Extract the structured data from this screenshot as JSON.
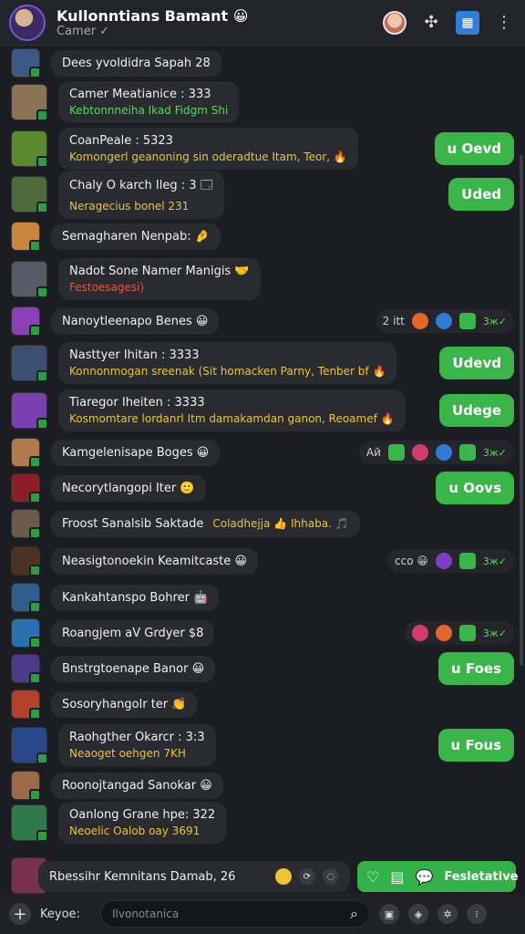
{
  "header": {
    "title": "Kullonntians Bamant 😀",
    "subtitle": "Camer ✓",
    "icons": [
      "profile-picture-icon",
      "puzzle-icon",
      "app-grid-icon",
      "more-vertical-icon"
    ]
  },
  "messages": [
    {
      "name": "Dees yvoldidra Sapah 28",
      "msg": "",
      "color": "yellow",
      "right": null,
      "av": "#3c5a86"
    },
    {
      "name": "Camer Meatianice : 333",
      "msg": "Kebtonnneiha Ikad Fidgm Shi",
      "color": "green",
      "right": null,
      "av": "#8b7355"
    },
    {
      "name": "CoanPeale : 5323",
      "msg": "Komongerl geanoning sin oderadtue Itam, Teor, 🔥",
      "color": "yellow",
      "right": {
        "type": "button",
        "label": "u Oevd"
      },
      "av": "#5b8a2e"
    },
    {
      "name": "Chaly O karch Ileg : 3  🗔",
      "msg": "Neragecius bonel 231",
      "color": "yellow",
      "right": {
        "type": "button",
        "label": "Uded"
      },
      "av": "#4d6b3a"
    },
    {
      "name": "Semagharen Nenpab: 🤌",
      "msg": "",
      "color": "yellow",
      "right": null,
      "av": "#c9853c"
    },
    {
      "name": "Nadot Sone Namer Manigis 🤝",
      "msg": "Festoesagesi)",
      "color": "red",
      "right": null,
      "av": "#555c66"
    },
    {
      "name": "Nanoytleenapo Benes 😀",
      "msg": "",
      "color": "yellow",
      "right": {
        "type": "react",
        "text": "2 itt",
        "dots": [
          "o",
          "b",
          "g"
        ],
        "check": "3ж✓"
      },
      "av": "#8a3fb8"
    },
    {
      "name": "Nasttyer Ihitan : 3333",
      "msg": "Konnonmogan sreenak (Sit homacken Parny, Tenber bf 🔥",
      "color": "yellow",
      "right": {
        "type": "button",
        "label": "Udevd"
      },
      "av": "#3b4f6e"
    },
    {
      "name": "Tiaregor Iheiten : 3333",
      "msg": "Kosmomtare lordanrl Itm damakamdan ganon, Reoamef 🔥",
      "color": "yellow",
      "right": {
        "type": "button",
        "label": "Udege"
      },
      "av": "#7a3fb0"
    },
    {
      "name": "Kamgelenisape Boges 😀",
      "msg": "",
      "color": "yellow",
      "right": {
        "type": "react",
        "text": "Ай",
        "dots": [
          "g",
          "k",
          "b",
          "g"
        ],
        "check": "3ж✓"
      },
      "av": "#b37a4c"
    },
    {
      "name": "Necorytlangopi Iter 🙂",
      "msg": "",
      "color": "yellow",
      "right": {
        "type": "button",
        "label": "u Oovs"
      },
      "av": "#8a1f2a"
    },
    {
      "name": "Froost Sanalsib Saktade",
      "msg": "Coladhejja 👍 Ihhaba. 🎵",
      "color": "yellow",
      "right": null,
      "av": "#6a5a4a",
      "inline": true
    },
    {
      "name": "Neasigtonoekin Keamitcaste 😀",
      "msg": "",
      "color": "yellow",
      "right": {
        "type": "react",
        "text": "cco 😀",
        "dots": [
          "p",
          "g"
        ],
        "check": "3ж✓"
      },
      "av": "#4a3322"
    },
    {
      "name": "Kankahtanspo Bohrer 🤖",
      "msg": "",
      "color": "yellow",
      "right": null,
      "av": "#2d5f8a"
    },
    {
      "name": "Roangjem aV Grdyer $8",
      "msg": "",
      "color": "yellow",
      "right": {
        "type": "react",
        "text": "",
        "dots": [
          "k",
          "o",
          "g"
        ],
        "check": "3ж✓"
      },
      "av": "#2a6fb0"
    },
    {
      "name": "Bnstrgtoenape Banor 😀",
      "msg": "",
      "color": "yellow",
      "right": {
        "type": "button",
        "label": "u Foes"
      },
      "av": "#4b3a8a"
    },
    {
      "name": "Sosoryhangolr ter 👏",
      "msg": "",
      "color": "yellow",
      "right": null,
      "av": "#b3402a"
    },
    {
      "name": "Raohgther Okarcr : 3:3",
      "msg": "Neaoget oehgen 7KH",
      "color": "yellow",
      "right": {
        "type": "button",
        "label": "u Fous"
      },
      "av": "#27478a"
    },
    {
      "name": "Roonojtangad Sanokar 😀",
      "msg": "",
      "color": "yellow",
      "right": null,
      "av": "#9a6a4a"
    },
    {
      "name": "Oanlong Grane hpe: 322",
      "msg": "Neoelic Oalob oay 3691",
      "color": "yellow",
      "right": null,
      "av": "#2f7a4a"
    }
  ],
  "actionbar": {
    "name": "Rbessihr Kemnitans Damab, 26",
    "panel_label": "Fesletative"
  },
  "composer": {
    "label": "Keyoe:",
    "placeholder": "Ilvonotanica"
  }
}
